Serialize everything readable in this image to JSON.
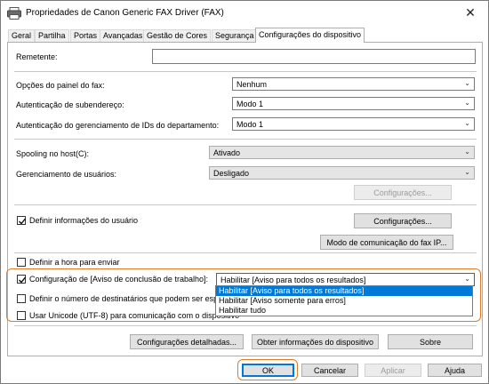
{
  "window": {
    "title": "Propriedades de Canon Generic FAX Driver (FAX)"
  },
  "tabs": [
    {
      "label": "Geral"
    },
    {
      "label": "Partilha"
    },
    {
      "label": "Portas"
    },
    {
      "label": "Avançadas"
    },
    {
      "label": "Gestão de Cores"
    },
    {
      "label": "Segurança"
    },
    {
      "label": "Configurações do dispositivo",
      "active": true
    }
  ],
  "form": {
    "remetente_label": "Remetente:",
    "remetente_value": "",
    "opcoes_painel_label": "Opções do painel do fax:",
    "opcoes_painel_value": "Nenhum",
    "subenderecos_label": "Autenticação de subendereço:",
    "subenderecos_value": "Modo 1",
    "gerenc_ids_label": "Autenticação do gerenciamento de IDs do departamento:",
    "gerenc_ids_value": "Modo 1",
    "spooling_label": "Spooling no host(C):",
    "spooling_value": "Ativado",
    "gerenc_usuarios_label": "Gerenciamento de usuários:",
    "gerenc_usuarios_value": "Desligado",
    "config_btn_disabled": "Configurações...",
    "definir_info_label": "Definir informações do usuário",
    "definir_info_checked": true,
    "config_btn": "Configurações...",
    "modo_comunicacao_btn": "Modo de comunicação do fax IP...",
    "definir_hora_label": "Definir a hora para enviar",
    "definir_hora_checked": false,
    "aviso_label": "Configuração de [Aviso de conclusão de trabalho]:",
    "aviso_checked": true,
    "aviso_value": "Habilitar [Aviso para todos os resultados]",
    "aviso_options": [
      "Habilitar [Aviso para todos os resultados]",
      "Habilitar [Aviso somente para erros]",
      "Habilitar tudo"
    ],
    "aviso_selected_index": 0,
    "num_destinatarios_label": "Definir o número de destinatários que podem ser espec",
    "num_destinatarios_checked": false,
    "unicode_label": "Usar Unicode (UTF-8) para comunicação com o dispositivo",
    "unicode_checked": false,
    "config_detalhadas_btn": "Configurações detalhadas...",
    "obter_info_btn": "Obter informações do dispositivo",
    "sobre_btn": "Sobre"
  },
  "footer": {
    "ok": "OK",
    "cancelar": "Cancelar",
    "aplicar": "Aplicar",
    "ajuda": "Ajuda"
  },
  "colors": {
    "accent": "#0078d7",
    "highlight": "#e07b28"
  }
}
